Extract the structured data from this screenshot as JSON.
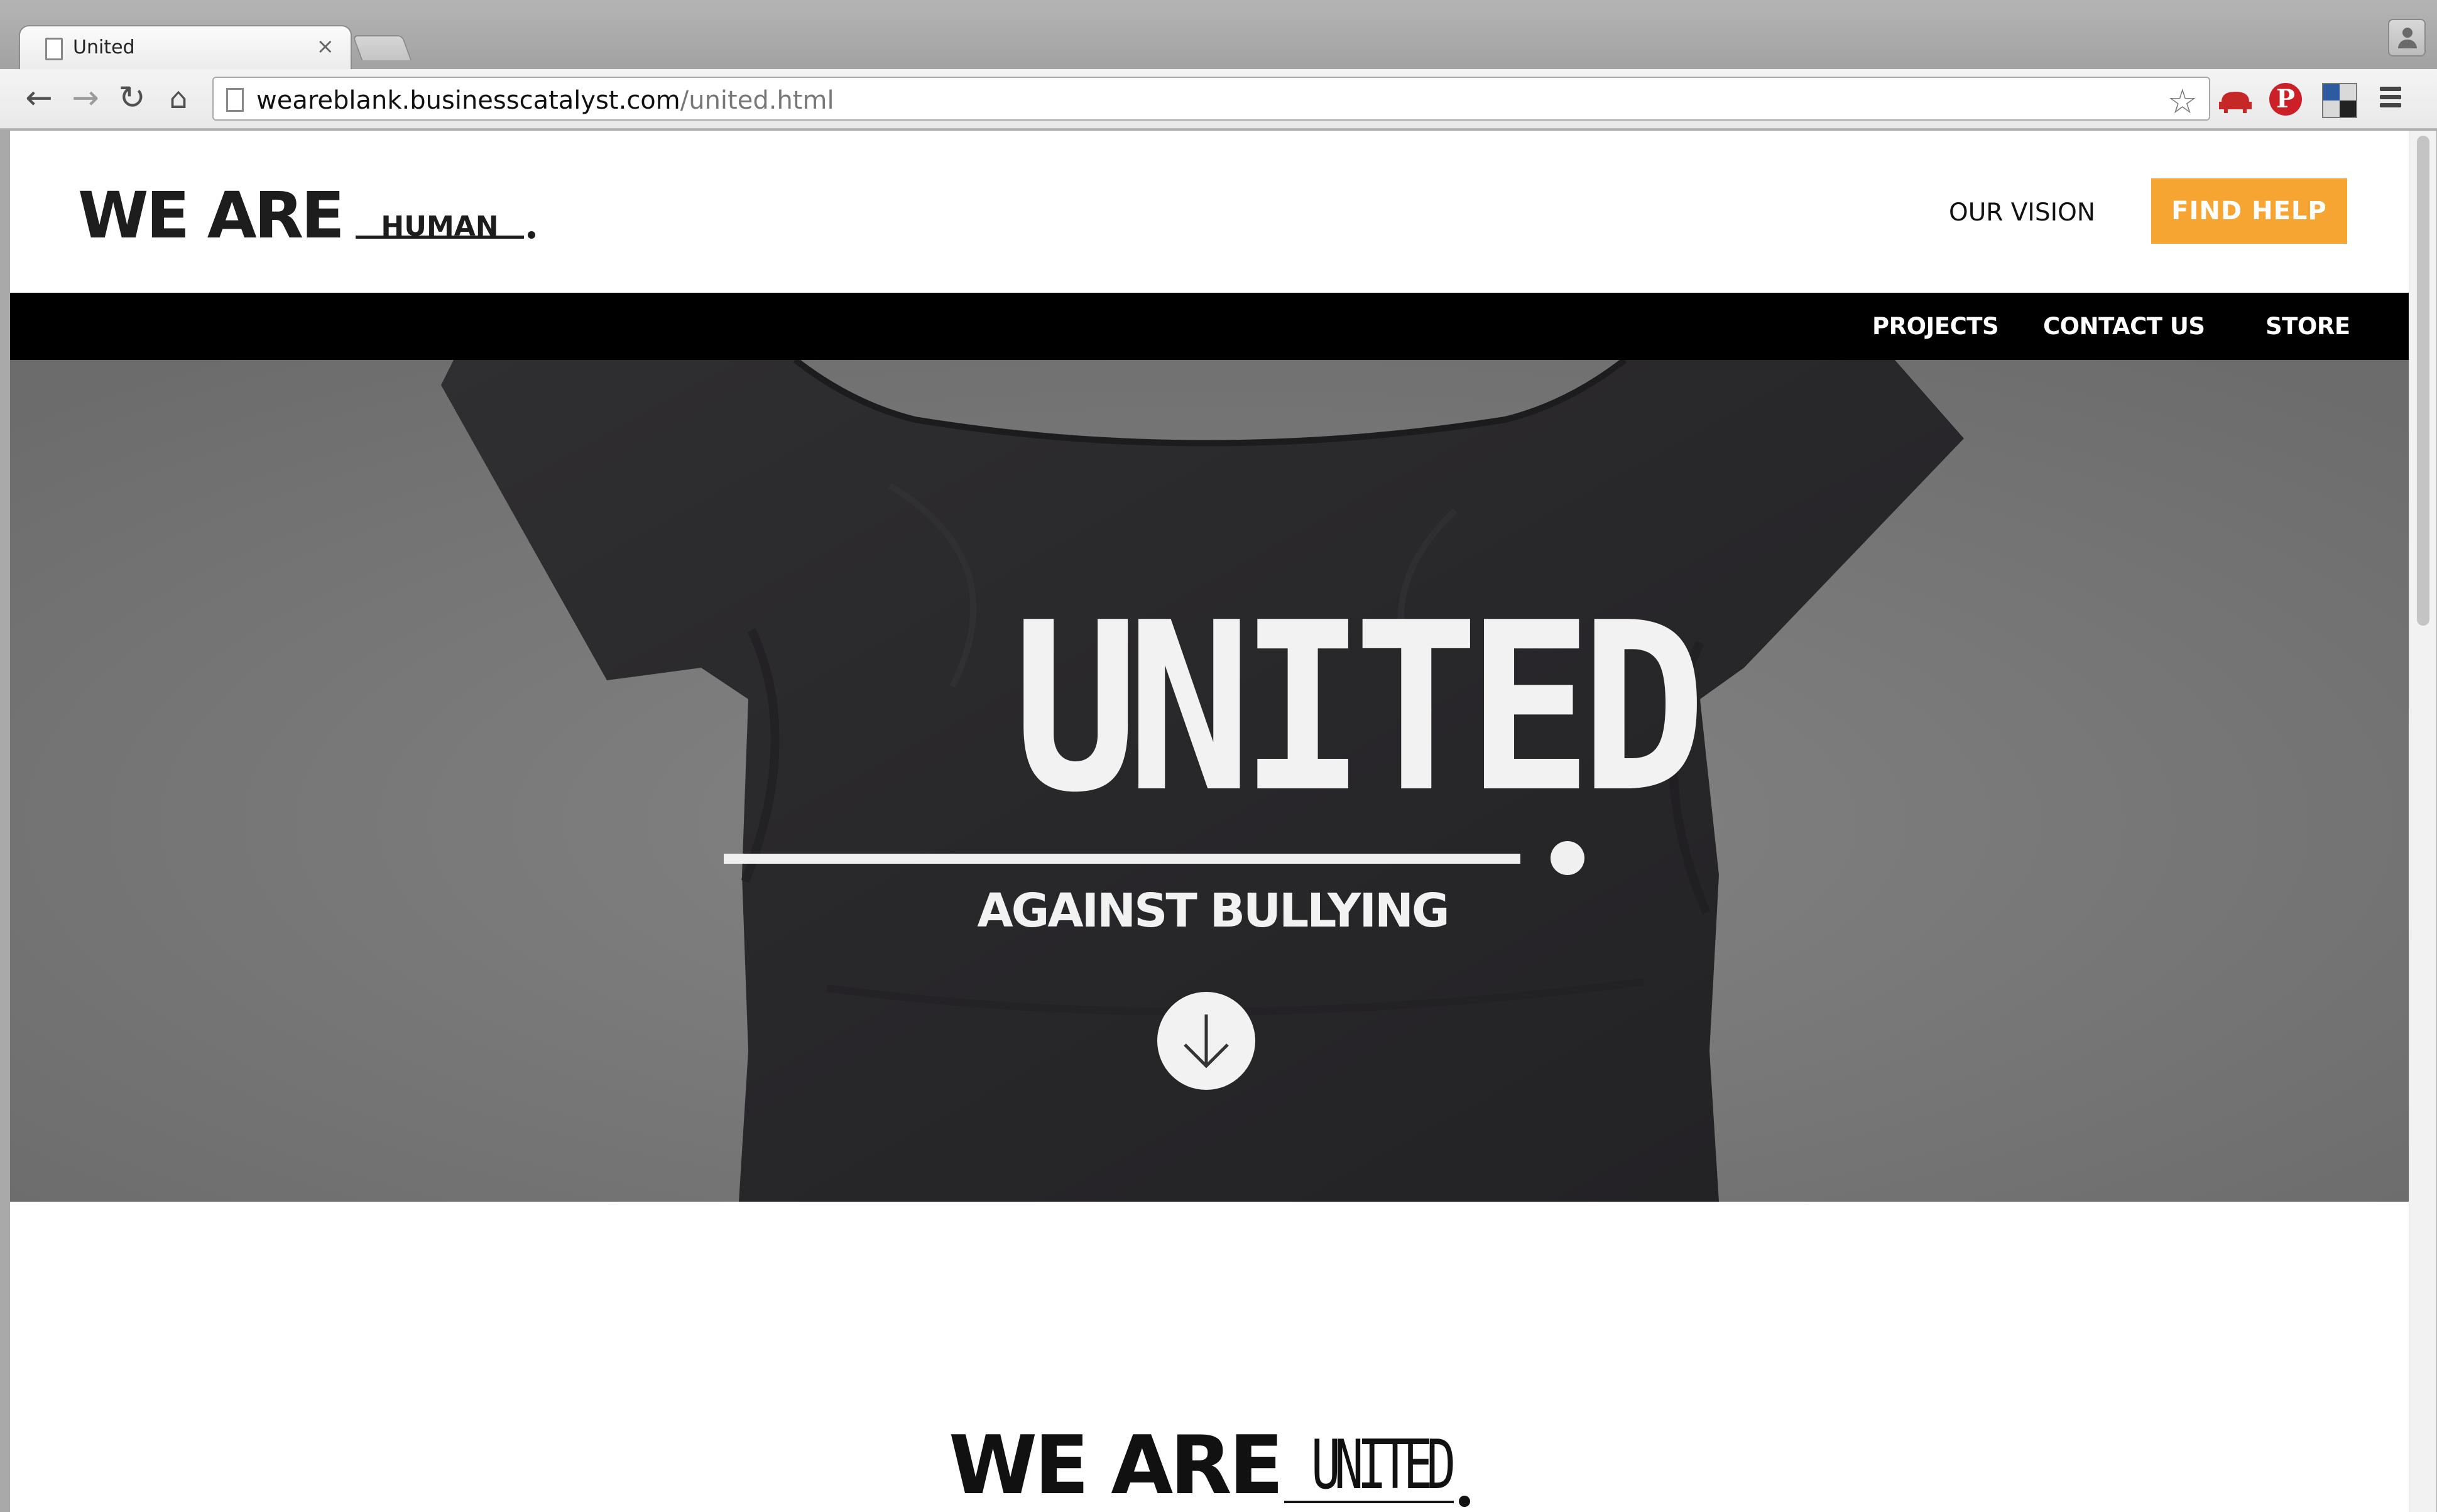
{
  "browser": {
    "tab": {
      "title": "United",
      "close": "×"
    },
    "url": {
      "host": "weareblank.businesscatalyst.com",
      "path": "/united.html"
    },
    "icons": {
      "back": "←",
      "forward": "→",
      "reload": "↻",
      "home": "⌂",
      "star": "☆",
      "pinterest": "P"
    }
  },
  "header": {
    "logo": {
      "prefix": "WE ARE",
      "word": "HUMAN"
    },
    "our_vision": "OUR VISION",
    "find_help": "FIND HELP"
  },
  "nav": {
    "items": [
      {
        "label": "PROJECTS"
      },
      {
        "label": "CONTACT US"
      },
      {
        "label": "STORE"
      }
    ]
  },
  "hero": {
    "title": "UNITED",
    "subtitle": "AGAINST BULLYING"
  },
  "section": {
    "logo": {
      "prefix": "WE ARE",
      "word": "UNITED"
    }
  },
  "colors": {
    "accent": "#f6a533",
    "nav_bg": "#000000",
    "hero_bg": "#777777",
    "shirt": "#29282a"
  }
}
